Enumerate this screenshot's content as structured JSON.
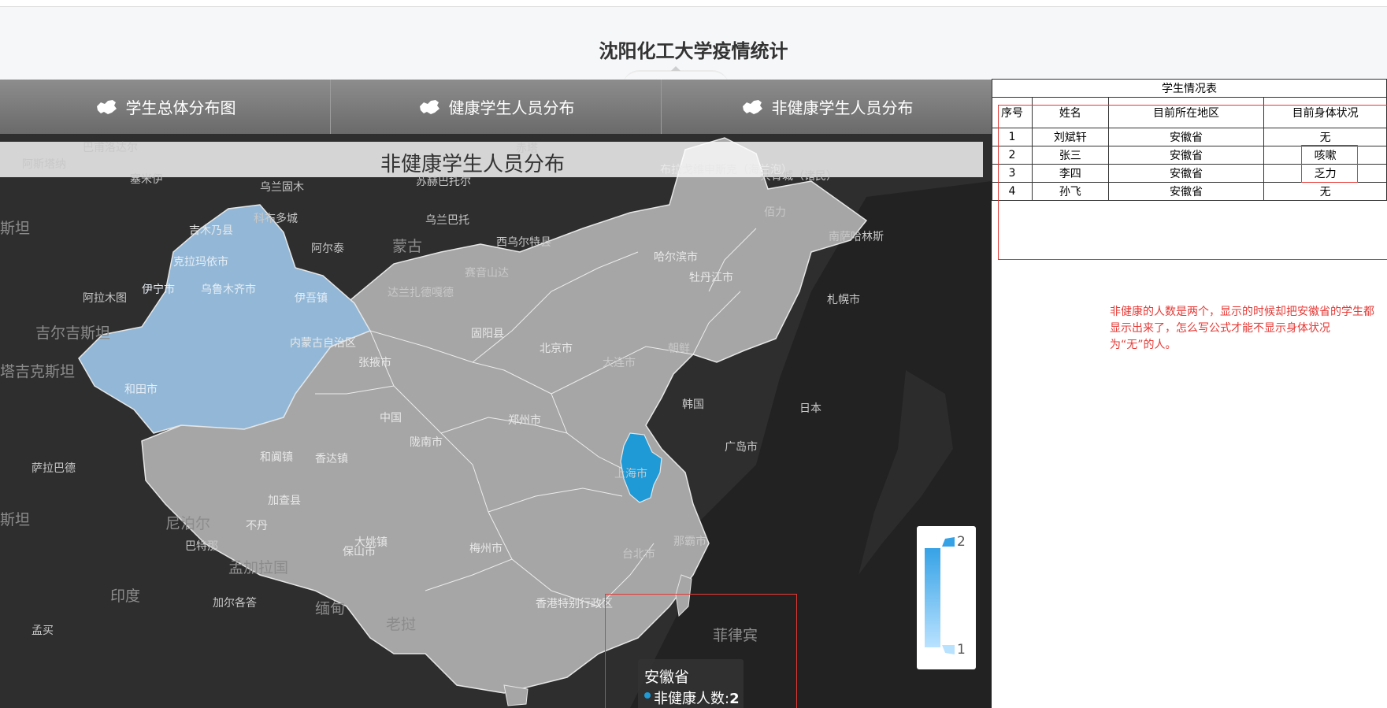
{
  "page": {
    "title": "沈阳化工大学疫情统计"
  },
  "tabs": [
    {
      "label": "学生总体分布图",
      "icon": "china-map-icon"
    },
    {
      "label": "健康学生人员分布",
      "icon": "china-map-icon"
    },
    {
      "label": "非健康学生人员分布",
      "icon": "china-map-icon"
    }
  ],
  "map": {
    "title": "非健康学生人员分布",
    "highlighted_province": "安徽省",
    "tooltip": {
      "name": "安徽省",
      "label": "非健康人数:",
      "value": "2"
    },
    "legend": {
      "max": "2",
      "min": "1"
    },
    "colors": {
      "ocean": "#222222",
      "country": "#a6a6a6",
      "xinjiang": "#93b8d7",
      "anhui": "#1f9ad6"
    },
    "places": [
      "巴甫洛达尔",
      "阿斯塔纳",
      "塞米伊",
      "乌兰固木",
      "苏赫巴托尔",
      "赤塔",
      "共青城（诸民）",
      "布拉戈维申斯克（海兰泡）",
      "吉木乃县",
      "科布多城",
      "乌兰巴托",
      "西乌尔特县",
      "佰力",
      "斯坦",
      "克拉玛依市",
      "乌鲁木齐市",
      "阿尔泰",
      "蒙古",
      "南萨哈林斯",
      "伊宁市",
      "伊吾镇",
      "赛音山达",
      "哈尔滨市",
      "阿拉木图",
      "达兰扎德嘎德",
      "牡丹江市",
      "札幌市",
      "吉尔吉斯坦",
      "固阳县",
      "内蒙古自治区",
      "北京市",
      "朝鲜",
      "塔吉克斯坦",
      "和田市",
      "张掖市",
      "大连市",
      "中国",
      "韩国",
      "郑州市",
      "日本",
      "陇南市",
      "广岛市",
      "萨拉巴德",
      "和阗镇",
      "香达镇",
      "上海市",
      "加查县",
      "斯坦",
      "尼泊尔",
      "不丹",
      "巴特那",
      "大姚镇",
      "孟加拉国",
      "保山市",
      "梅州市",
      "那霸市",
      "台北市",
      "印度",
      "加尔各答",
      "缅甸",
      "香港特别行政区",
      "老挝",
      "孟买",
      "菲律宾"
    ]
  },
  "student_table": {
    "caption": "学生情况表",
    "headers": [
      "序号",
      "姓名",
      "目前所在地区",
      "目前身体状况"
    ],
    "rows": [
      [
        "1",
        "刘斌轩",
        "安徽省",
        "无"
      ],
      [
        "2",
        "张三",
        "安徽省",
        "咳嗽"
      ],
      [
        "3",
        "李四",
        "安徽省",
        "乏力"
      ],
      [
        "4",
        "孙飞",
        "安徽省",
        "无"
      ]
    ]
  },
  "note": "非健康的人数是两个，显示的时候却把安徽省的学生都显示出来了，怎么写公式才能不显示身体状况为“无”的人。"
}
